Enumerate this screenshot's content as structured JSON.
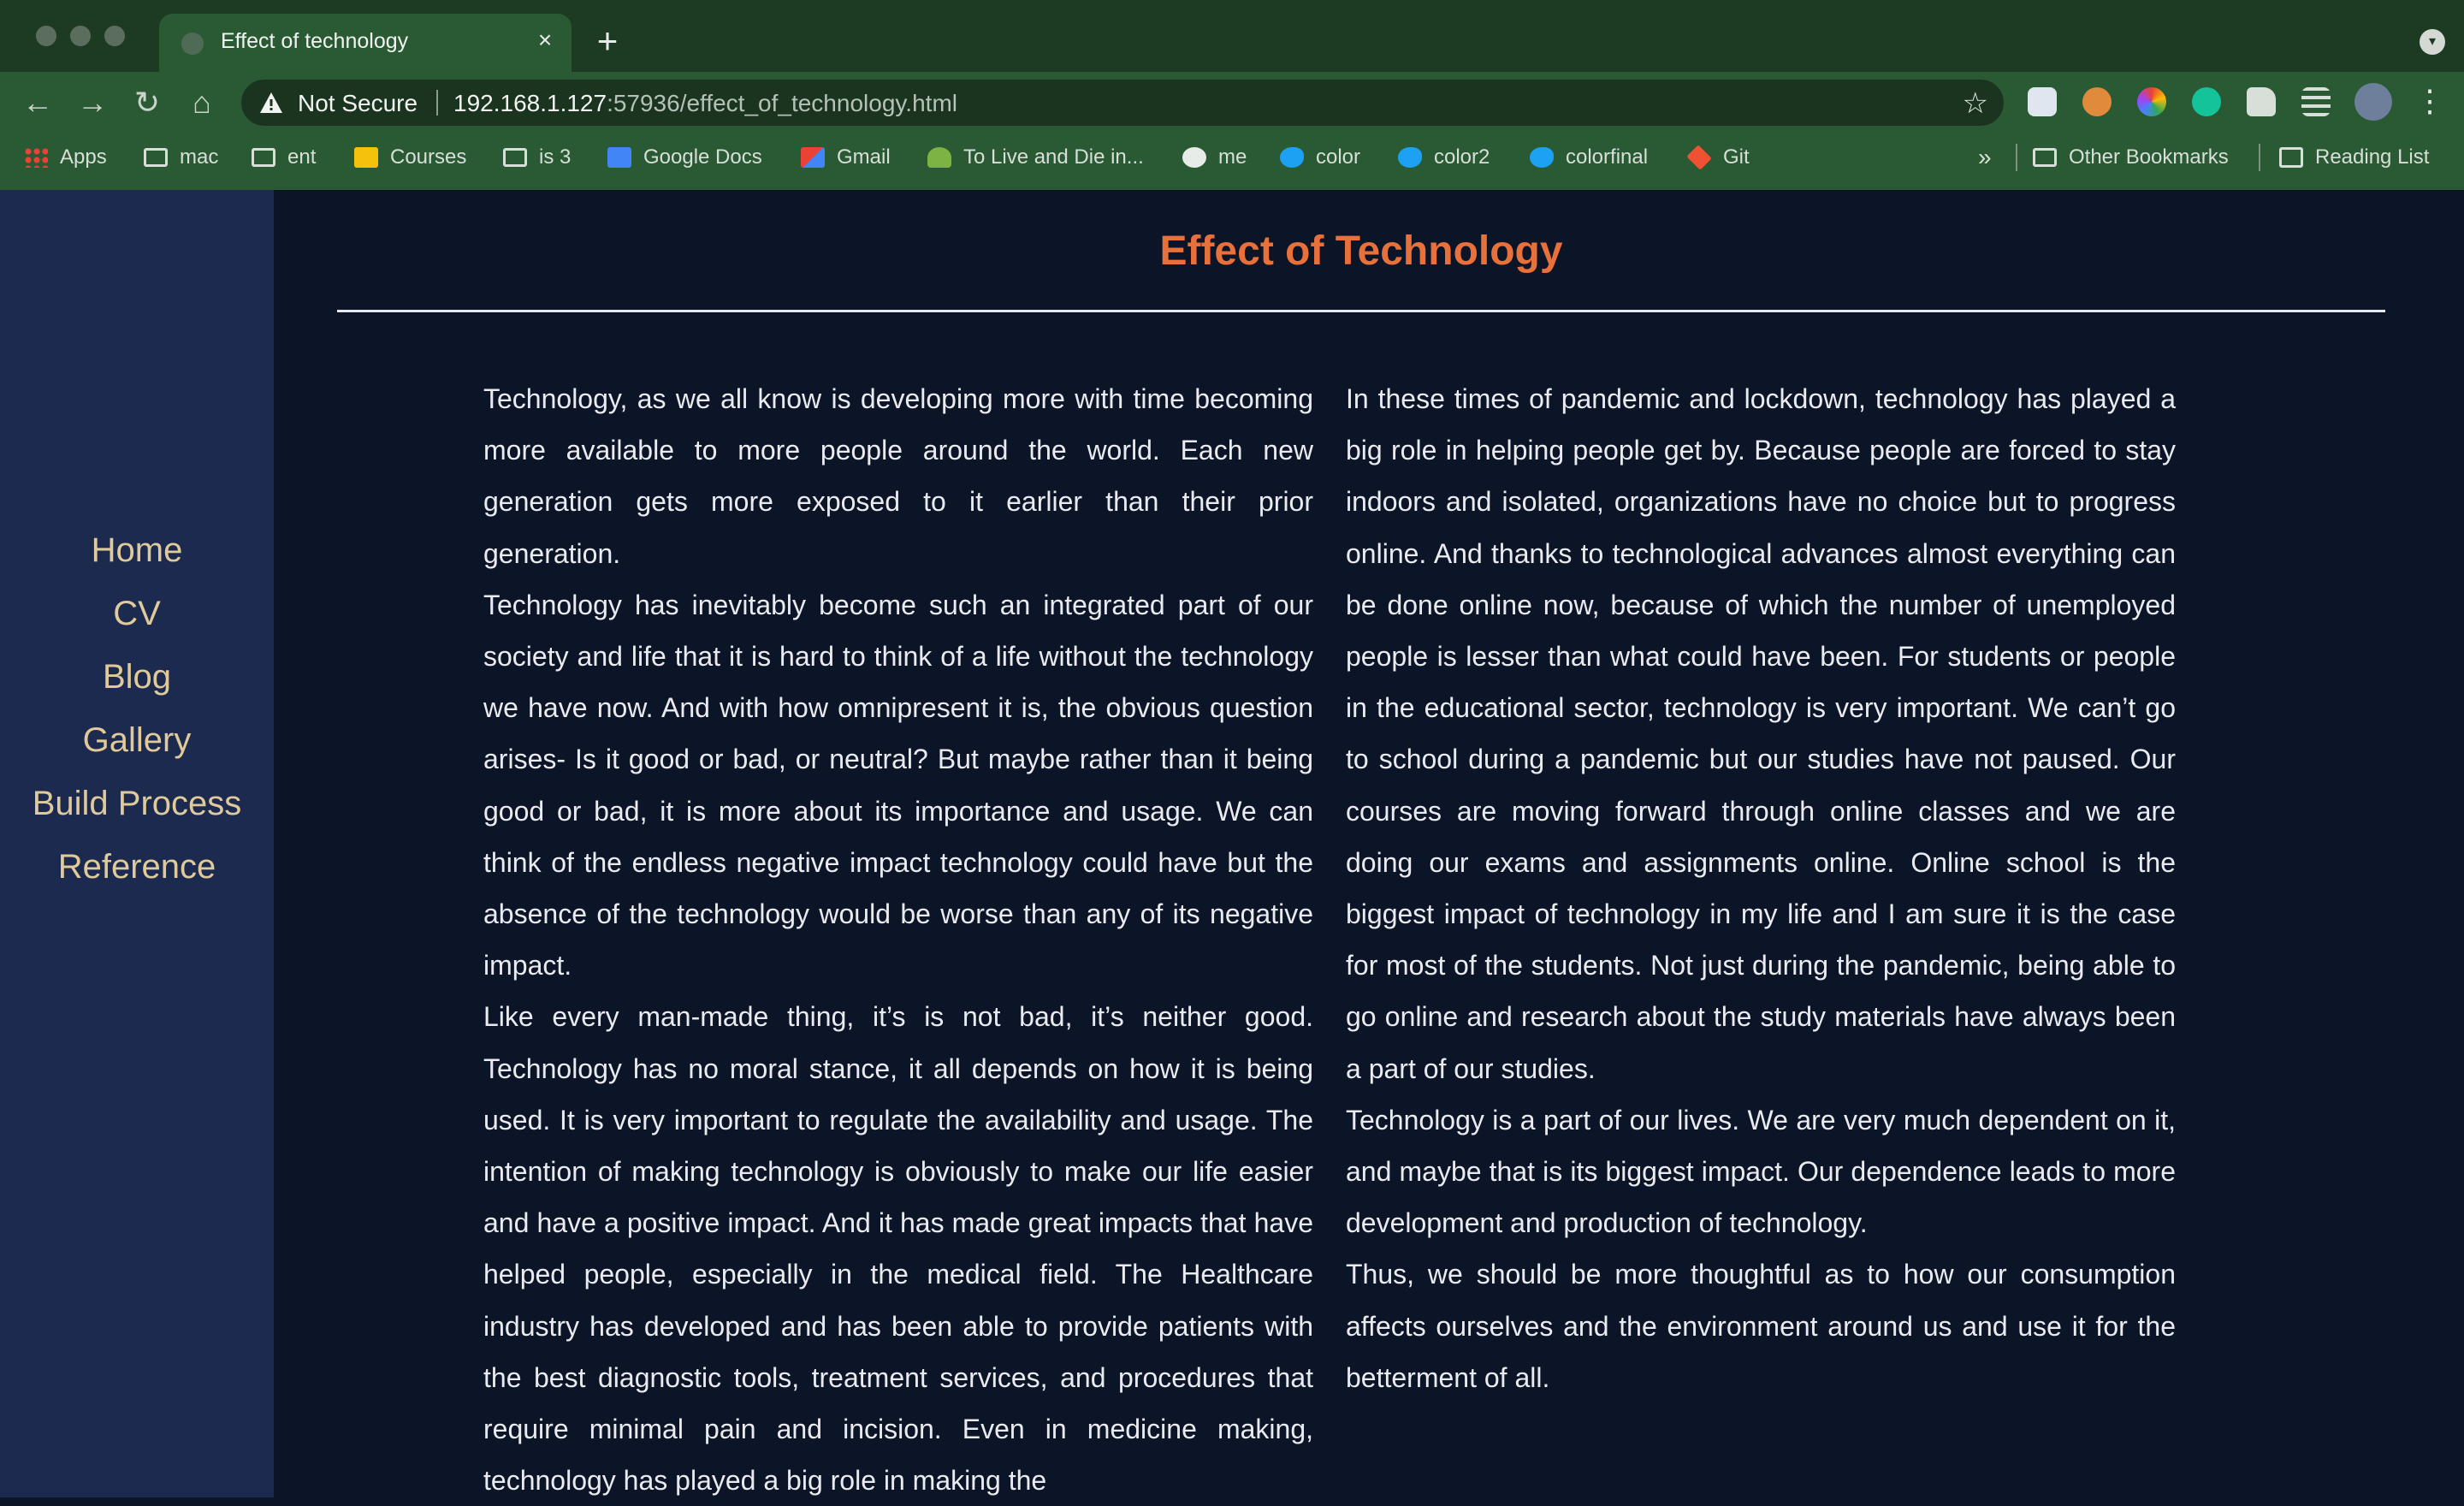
{
  "browser": {
    "tab_title": "Effect of technology",
    "tab_close": "×",
    "new_tab": "+",
    "security_label": "Not Secure",
    "url_host": "192.168.1.127",
    "url_path": ":57936/effect_of_technology.html",
    "bookmarks": [
      {
        "label": "Apps",
        "icon": "apps-icon"
      },
      {
        "label": "mac",
        "icon": "folder-icon"
      },
      {
        "label": "ent",
        "icon": "folder-icon"
      },
      {
        "label": "Courses",
        "icon": "drive-icon"
      },
      {
        "label": "is 3",
        "icon": "folder-icon"
      },
      {
        "label": "Google Docs",
        "icon": "docs-icon"
      },
      {
        "label": "Gmail",
        "icon": "gmail-icon"
      },
      {
        "label": "To Live and Die in...",
        "icon": "leaf-icon"
      },
      {
        "label": "me",
        "icon": "globe-icon"
      },
      {
        "label": "color",
        "icon": "twitter-icon"
      },
      {
        "label": "color2",
        "icon": "twitter-icon"
      },
      {
        "label": "colorfinal",
        "icon": "twitter-icon"
      },
      {
        "label": "Git",
        "icon": "git-icon"
      }
    ],
    "bookmarks_more": "»",
    "other_bookmarks": "Other Bookmarks",
    "reading_list": "Reading List"
  },
  "sidebar": {
    "items": [
      {
        "label": "Home"
      },
      {
        "label": "CV"
      },
      {
        "label": "Blog"
      },
      {
        "label": "Gallery"
      },
      {
        "label": "Build Process"
      },
      {
        "label": "Reference"
      }
    ]
  },
  "article": {
    "title": "Effect of Technology",
    "left_paragraphs": [
      "Technology, as we all know is developing more with time becoming more available to more people around the world. Each new generation gets more exposed to it earlier than their prior generation.",
      "Technology has inevitably become such an integrated part of our society and life that it is hard to think of a life without the technology we have now. And with how omnipresent it is, the obvious question arises- Is it good or bad, or neutral? But maybe rather than it being good or bad, it is more about its importance and usage. We can think of the endless negative impact technology could have but the absence of the technology would be worse than any of its negative impact.",
      "Like every man-made thing, it’s is not bad, it’s neither good. Technology has no moral stance, it all depends on how it is being used. It is very important to regulate the availability and usage. The intention of making technology is obviously to make our life easier and have a positive impact. And it has made great impacts that have helped people, especially in the medical field. The Healthcare industry has developed and has been able to provide patients with the best diagnostic tools, treatment services, and procedures that require minimal pain and incision. Even in medicine making, technology has played a big role in making the"
    ],
    "right_paragraphs": [
      "In these times of pandemic and lockdown, technology has played a big role in helping people get by. Because people are forced to stay indoors and isolated, organizations have no choice but to progress online. And thanks to technological advances almost everything can be done online now, because of which the number of unemployed people is lesser than what could have been. For students or people in the educational sector, technology is very important. We can’t go to school during a pandemic but our studies have not paused. Our courses are moving forward through online classes and we are doing our exams and assignments online. Online school is the biggest impact of technology in my life and I am sure it is the case for most of the students. Not just during the pandemic, being able to go online and research about the study materials have always been a part of our studies.",
      "Technology is a part of our lives. We are very much dependent on it, and maybe that is its biggest impact. Our dependence leads to more development and production of technology.",
      "Thus, we should be more thoughtful as to how our consumption affects ourselves and the environment around us and use it for the betterment of all."
    ]
  }
}
